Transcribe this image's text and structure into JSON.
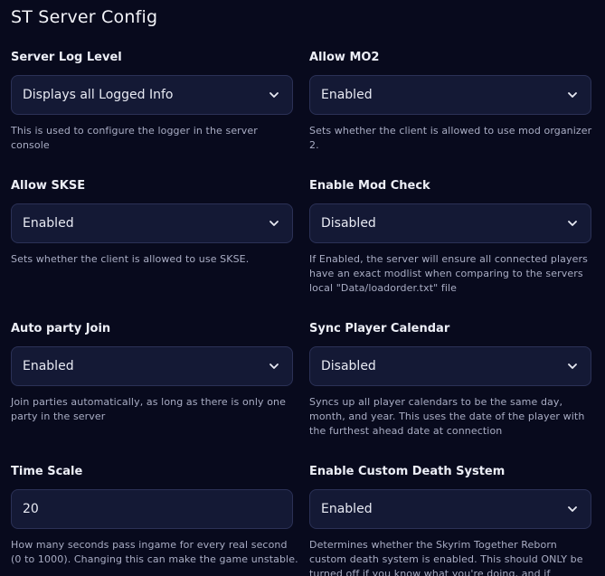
{
  "page": {
    "title": "ST Server Config"
  },
  "fields": [
    {
      "label": "Server Log Level",
      "value": "Displays all Logged Info",
      "control": "select",
      "help": "This is used to configure the logger in the server console"
    },
    {
      "label": "Allow MO2",
      "value": "Enabled",
      "control": "select",
      "help": "Sets whether the client is allowed to use mod organizer 2."
    },
    {
      "label": "Allow SKSE",
      "value": "Enabled",
      "control": "select",
      "help": "Sets whether the client is allowed to use SKSE."
    },
    {
      "label": "Enable Mod Check",
      "value": "Disabled",
      "control": "select",
      "help": "If Enabled, the server will ensure all connected players have an exact modlist when comparing to the servers local \"Data/loadorder.txt\" file"
    },
    {
      "label": "Auto party Join",
      "value": "Enabled",
      "control": "select",
      "help": "Join parties automatically, as long as there is only one party in the server"
    },
    {
      "label": "Sync Player Calendar",
      "value": "Disabled",
      "control": "select",
      "help": "Syncs up all player calendars to be the same day, month, and year. This uses the date of the player with the furthest ahead date at connection"
    },
    {
      "label": "Time Scale",
      "value": "20",
      "control": "input",
      "help": "How many seconds pass ingame for every real second (0 to 1000). Changing this can make the game unstable."
    },
    {
      "label": "Enable Custom Death System",
      "value": "Enabled",
      "control": "select",
      "help": "Determines whether the Skyrim Together Reborn custom death system is enabled. This should ONLY be turned off if you know what you're doing, and if"
    }
  ],
  "icons": {
    "dropdown": "chevron-down-icon"
  },
  "colors": {
    "background": "#080a1d",
    "control_background": "#141935",
    "control_border": "#2b3156",
    "label_text": "#eceef6",
    "help_text": "#a9adc4"
  }
}
